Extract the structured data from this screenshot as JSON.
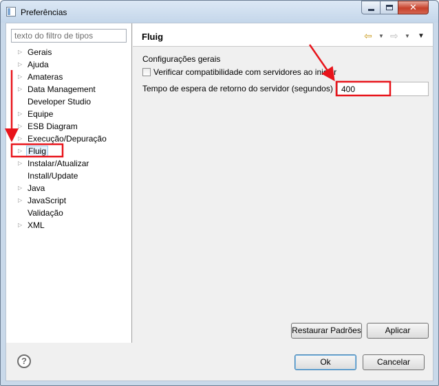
{
  "window": {
    "title": "Preferências",
    "min_label": "minimize",
    "max_label": "maximize",
    "close_glyph": "✕"
  },
  "filter": {
    "placeholder": "texto do filtro de tipos",
    "value": ""
  },
  "tree": {
    "items": [
      {
        "label": "Gerais",
        "expandable": true
      },
      {
        "label": "Ajuda",
        "expandable": true
      },
      {
        "label": "Amateras",
        "expandable": true
      },
      {
        "label": "Data Management",
        "expandable": true
      },
      {
        "label": "Developer Studio",
        "expandable": false
      },
      {
        "label": "Equipe",
        "expandable": true
      },
      {
        "label": "ESB Diagram",
        "expandable": true
      },
      {
        "label": "Execução/Depuração",
        "expandable": true
      },
      {
        "label": "Fluig",
        "expandable": true,
        "selected": true
      },
      {
        "label": "Instalar/Atualizar",
        "expandable": true
      },
      {
        "label": "Install/Update",
        "expandable": false
      },
      {
        "label": "Java",
        "expandable": true
      },
      {
        "label": "JavaScript",
        "expandable": true
      },
      {
        "label": "Validação",
        "expandable": false
      },
      {
        "label": "XML",
        "expandable": true
      }
    ]
  },
  "page": {
    "title": "Fluig",
    "nav_icons": [
      "back-arrow-icon",
      "forward-arrow-icon",
      "view-menu-icon"
    ],
    "section_label": "Configurações gerais",
    "checkbox_label": "Verificar compatibilidade com servidores ao iniciar",
    "checkbox_checked": false,
    "timeout_label": "Tempo de espera de retorno do servidor (segundos)",
    "timeout_value": "400"
  },
  "buttons": {
    "restore": "Restaurar Padrões",
    "apply": "Aplicar",
    "ok": "Ok",
    "cancel": "Cancelar"
  },
  "help_glyph": "?",
  "colors": {
    "annotation_red": "#e8141b",
    "selection_fill": "#e5f1fb",
    "close_button": "#c7412b"
  }
}
